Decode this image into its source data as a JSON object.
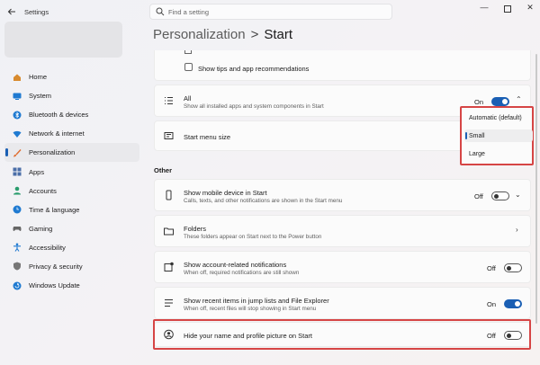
{
  "window": {
    "app_title": "Settings",
    "controls": [
      "minimize",
      "maximize",
      "close"
    ]
  },
  "search": {
    "placeholder": "Find a setting"
  },
  "sidebar": {
    "items": [
      {
        "label": "Home",
        "icon": "home-icon",
        "color": "#d88a2e"
      },
      {
        "label": "System",
        "icon": "monitor-icon",
        "color": "#1f7ad1"
      },
      {
        "label": "Bluetooth & devices",
        "icon": "bluetooth-icon",
        "color": "#1f7ad1"
      },
      {
        "label": "Network & internet",
        "icon": "wifi-icon",
        "color": "#1f7ad1"
      },
      {
        "label": "Personalization",
        "icon": "brush-icon",
        "color": "#e06b2c",
        "active": true
      },
      {
        "label": "Apps",
        "icon": "apps-icon",
        "color": "#4b6ea8"
      },
      {
        "label": "Accounts",
        "icon": "person-icon",
        "color": "#2a9d6d"
      },
      {
        "label": "Time & language",
        "icon": "globe-clock-icon",
        "color": "#1f7ad1"
      },
      {
        "label": "Gaming",
        "icon": "controller-icon",
        "color": "#666666"
      },
      {
        "label": "Accessibility",
        "icon": "accessibility-icon",
        "color": "#1f7ad1"
      },
      {
        "label": "Privacy & security",
        "icon": "shield-icon",
        "color": "#777777"
      },
      {
        "label": "Windows Update",
        "icon": "update-icon",
        "color": "#1f7ad1"
      }
    ]
  },
  "breadcrumb": {
    "parent": "Personalization",
    "separator": ">",
    "current": "Start"
  },
  "main": {
    "tips_row": {
      "label": "Show tips and app recommendations"
    },
    "all_row": {
      "title": "All",
      "subtitle": "Show all installed apps and system components in Start",
      "state": "On"
    },
    "size_row": {
      "title": "Start menu size"
    },
    "section_other": "Other",
    "mobile_row": {
      "title": "Show mobile device in Start",
      "subtitle": "Calls, texts, and other notifications are shown in the Start menu",
      "state": "Off"
    },
    "folders_row": {
      "title": "Folders",
      "subtitle": "These folders appear on Start next to the Power button"
    },
    "notif_row": {
      "title": "Show account-related notifications",
      "subtitle": "When off, required notifications are still shown",
      "state": "Off"
    },
    "recent_row": {
      "title": "Show recent items in jump lists and File Explorer",
      "subtitle": "When off, recent files will stop showing in Start menu",
      "state": "On"
    },
    "hide_row": {
      "title": "Hide your name and profile picture on Start",
      "state": "Off"
    }
  },
  "dropdown": {
    "options": [
      "Automatic (default)",
      "Small",
      "Large"
    ],
    "selected": "Small"
  },
  "colors": {
    "accent": "#1a5fb4",
    "highlight": "#d64545"
  }
}
